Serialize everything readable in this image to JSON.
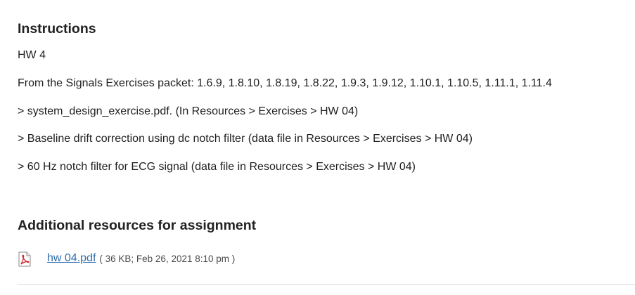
{
  "instructions": {
    "title": "Instructions",
    "lines": [
      "HW 4",
      "From the Signals Exercises packet: 1.6.9, 1.8.10, 1.8.19, 1.8.22, 1.9.3, 1.9.12, 1.10.1, 1.10.5, 1.11.1, 1.11.4",
      "> system_design_exercise.pdf. (In Resources > Exercises > HW 04)",
      "> Baseline drift correction using dc notch filter (data file in Resources > Exercises > HW 04)",
      "> 60 Hz notch filter for ECG signal (data file in Resources > Exercises > HW 04)"
    ]
  },
  "resources": {
    "title": "Additional resources for assignment",
    "attachment": {
      "icon": "pdf-file-icon",
      "file_name": "hw 04.pdf",
      "meta": "( 36 KB; Feb 26, 2021 8:10 pm )"
    }
  },
  "colors": {
    "link": "#2f6fae",
    "pdf_red": "#cc2b2b"
  }
}
